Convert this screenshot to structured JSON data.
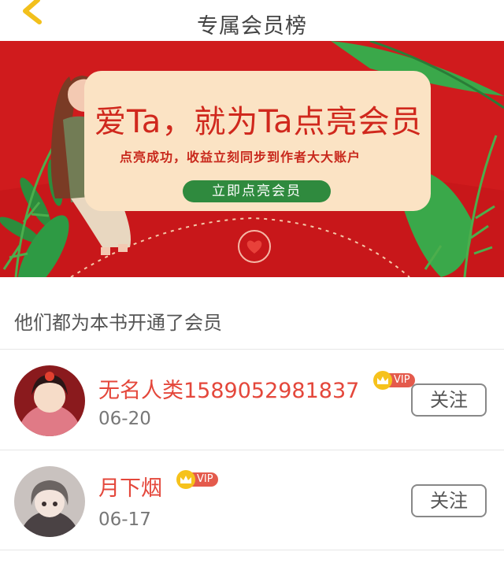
{
  "header": {
    "title": "专属会员榜",
    "back_icon": "chevron-left-icon"
  },
  "banner": {
    "headline": "爱Ta，就为Ta点亮会员",
    "subline": "点亮成功，收益立刻同步到作者大大账户",
    "cta_label": "立即点亮会员",
    "colors": {
      "background": "#d01b1d",
      "card": "#fbe3c4",
      "cta": "#2f8a3e",
      "text": "#d0281d"
    }
  },
  "section_title": "他们都为本书开通了会员",
  "members": [
    {
      "name": "无名人类1589052981837",
      "badge": "VIP",
      "date": "06-20",
      "follow_label": "关注"
    },
    {
      "name": "月下烟",
      "badge": "VIP",
      "date": "06-17",
      "follow_label": "关注"
    }
  ],
  "colors": {
    "name": "#e4473b",
    "vip": "#e45a4c",
    "crown": "#f6c21c"
  }
}
